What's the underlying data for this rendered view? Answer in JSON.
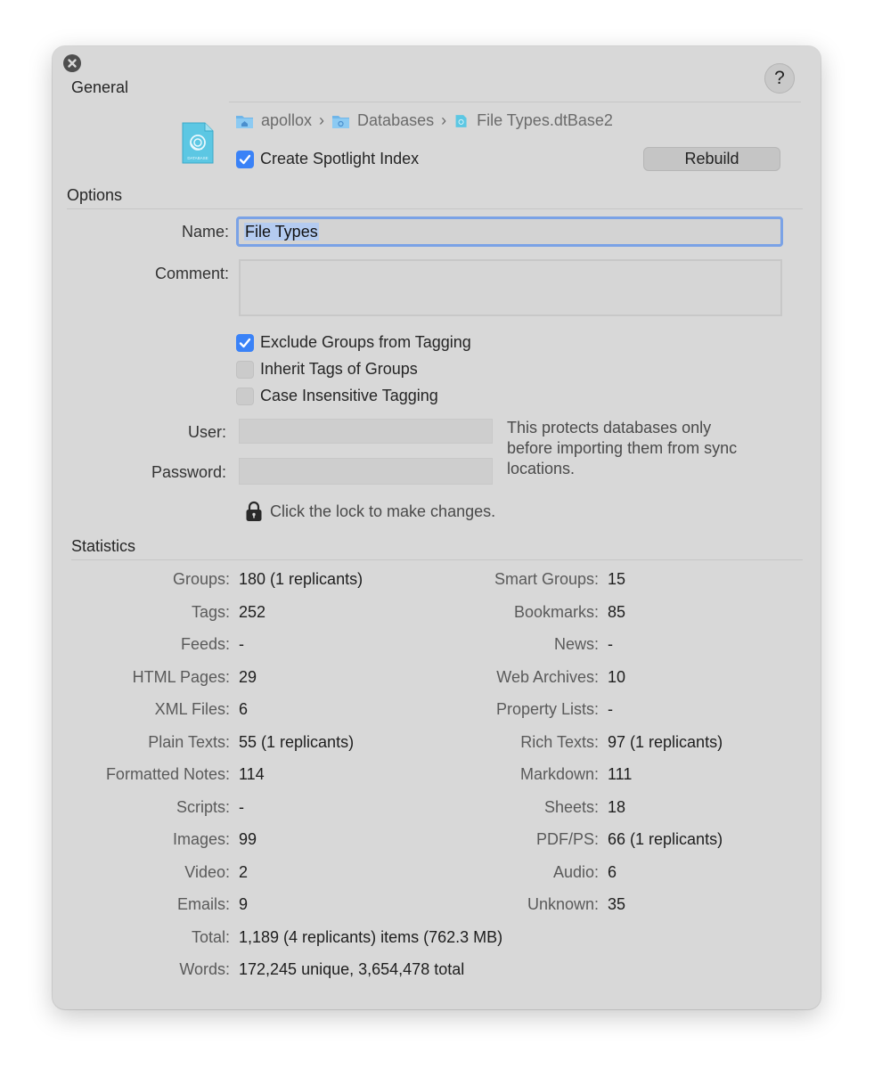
{
  "window": {
    "section_general": "General",
    "section_options": "Options",
    "section_statistics": "Statistics",
    "help_label": "?"
  },
  "general": {
    "path": [
      "apollox",
      "Databases",
      "File Types.dtBase2"
    ],
    "path_separator": "›",
    "create_spotlight_label": "Create Spotlight Index",
    "create_spotlight_checked": true,
    "rebuild_label": "Rebuild",
    "file_icon_caption": "DATABASE"
  },
  "options": {
    "name_label": "Name:",
    "name_value": "File Types",
    "comment_label": "Comment:",
    "comment_value": "",
    "exclude_groups_label": "Exclude Groups from Tagging",
    "exclude_groups_checked": true,
    "inherit_tags_label": "Inherit Tags of Groups",
    "inherit_tags_checked": false,
    "case_insensitive_label": "Case Insensitive Tagging",
    "case_insensitive_checked": false,
    "user_label": "User:",
    "password_label": "Password:",
    "protect_note_lines": [
      "This protects databases only",
      "before importing them from sync",
      "locations."
    ],
    "lock_text": "Click the lock to make changes."
  },
  "statistics": {
    "left": [
      {
        "label": "Groups:",
        "value": "180 (1 replicants)"
      },
      {
        "label": "Tags:",
        "value": "252"
      },
      {
        "label": "Feeds:",
        "value": "-"
      },
      {
        "label": "HTML Pages:",
        "value": "29"
      },
      {
        "label": "XML Files:",
        "value": "6"
      },
      {
        "label": "Plain Texts:",
        "value": "55 (1 replicants)"
      },
      {
        "label": "Formatted Notes:",
        "value": "114"
      },
      {
        "label": "Scripts:",
        "value": "-"
      },
      {
        "label": "Images:",
        "value": "99"
      },
      {
        "label": "Video:",
        "value": "2"
      },
      {
        "label": "Emails:",
        "value": "9"
      },
      {
        "label": "Total:",
        "value": "1,189 (4 replicants) items (762.3 MB)"
      },
      {
        "label": "Words:",
        "value": "172,245 unique, 3,654,478 total"
      }
    ],
    "right": [
      {
        "label": "Smart Groups:",
        "value": "15"
      },
      {
        "label": "Bookmarks:",
        "value": "85"
      },
      {
        "label": "News:",
        "value": "-"
      },
      {
        "label": "Web Archives:",
        "value": "10"
      },
      {
        "label": "Property Lists:",
        "value": "-"
      },
      {
        "label": "Rich Texts:",
        "value": "97 (1 replicants)"
      },
      {
        "label": "Markdown:",
        "value": "111"
      },
      {
        "label": "Sheets:",
        "value": "18"
      },
      {
        "label": "PDF/PS:",
        "value": "66 (1 replicants)"
      },
      {
        "label": "Audio:",
        "value": "6"
      },
      {
        "label": "Unknown:",
        "value": "35"
      }
    ]
  },
  "colors": {
    "panel_bg": "#d8d8d8",
    "accent": "#3a82f7",
    "focus_ring": "#7aa2e6"
  }
}
